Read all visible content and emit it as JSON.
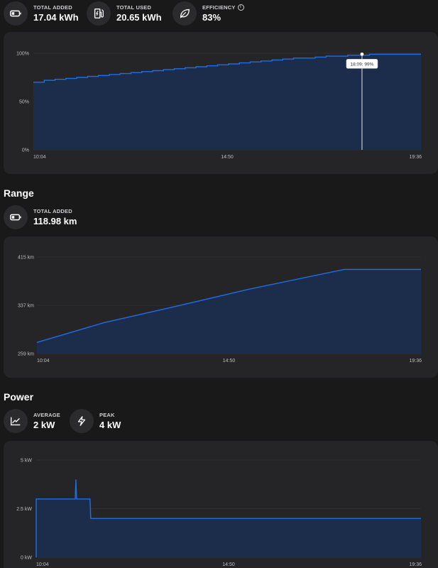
{
  "energy": {
    "stats": [
      {
        "label": "TOTAL ADDED",
        "value": "17.04 kWh",
        "icon": "battery-icon"
      },
      {
        "label": "TOTAL USED",
        "value": "20.65 kWh",
        "icon": "charging-station-icon"
      },
      {
        "label": "EFFICIENCY",
        "value": "83%",
        "icon": "leaf-icon"
      }
    ]
  },
  "range": {
    "title": "Range",
    "stats": [
      {
        "label": "TOTAL ADDED",
        "value": "118.98 km",
        "icon": "battery-icon"
      }
    ]
  },
  "power": {
    "title": "Power",
    "stats": [
      {
        "label": "AVERAGE",
        "value": "2 kW",
        "icon": "trend-chart-icon"
      },
      {
        "label": "PEAK",
        "value": "4 kW",
        "icon": "lightning-icon"
      }
    ]
  },
  "colors": {
    "line": "#1f6de6",
    "fill": "#1b2d4d",
    "grid": "#3a3a3d",
    "background": "#191919",
    "card": "#252527"
  },
  "chart_data": [
    {
      "type": "area",
      "ylabel_ticks": [
        "100%",
        "50%",
        "0%"
      ],
      "x_ticks": [
        "10:04",
        "14:50",
        "19:36"
      ],
      "ylim": [
        0,
        100
      ],
      "x": [
        "10:04",
        "10:20",
        "10:36",
        "10:52",
        "11:08",
        "11:24",
        "11:40",
        "11:56",
        "12:12",
        "12:28",
        "12:44",
        "13:00",
        "13:16",
        "13:32",
        "13:48",
        "14:04",
        "14:20",
        "14:36",
        "14:52",
        "15:08",
        "15:24",
        "15:40",
        "15:56",
        "16:12",
        "16:28",
        "16:44",
        "17:00",
        "17:16",
        "17:32",
        "17:48",
        "18:04",
        "18:20",
        "18:36",
        "18:52",
        "19:08",
        "19:24",
        "19:36"
      ],
      "series": [
        {
          "values": [
            70,
            72,
            73,
            74,
            75,
            76,
            77,
            78,
            79,
            80,
            81,
            82,
            83,
            84,
            85,
            86,
            87,
            88,
            89,
            90,
            91,
            92,
            93,
            94,
            95,
            95,
            96,
            97,
            97,
            98,
            98,
            99,
            99,
            99,
            99,
            99,
            99
          ]
        }
      ],
      "tooltip": {
        "text": "18:09: 99%",
        "x": "18:09",
        "y": 99
      },
      "grid": true
    },
    {
      "type": "line",
      "ylabel_ticks": [
        "415 km",
        "337 km",
        "259 km"
      ],
      "x_ticks": [
        "10:04",
        "14:50",
        "19:36"
      ],
      "ylim": [
        259,
        415
      ],
      "x": [
        "10:04",
        "11:44",
        "13:30",
        "15:20",
        "17:42",
        "19:36"
      ],
      "series": [
        {
          "values": [
            277,
            309,
            335,
            363,
            395,
            395
          ]
        }
      ],
      "grid": true
    },
    {
      "type": "area",
      "ylabel_ticks": [
        "5 kW",
        "2.5 kW",
        "0 kW"
      ],
      "x_ticks": [
        "10:04",
        "14:50",
        "19:36"
      ],
      "ylim": [
        0,
        5
      ],
      "x": [
        "10:04",
        "10:04",
        "11:02",
        "11:03",
        "11:04",
        "11:24",
        "11:25",
        "19:36"
      ],
      "series": [
        {
          "values": [
            0,
            3,
            3,
            4,
            3,
            3,
            2,
            2
          ]
        }
      ],
      "grid": true
    }
  ]
}
